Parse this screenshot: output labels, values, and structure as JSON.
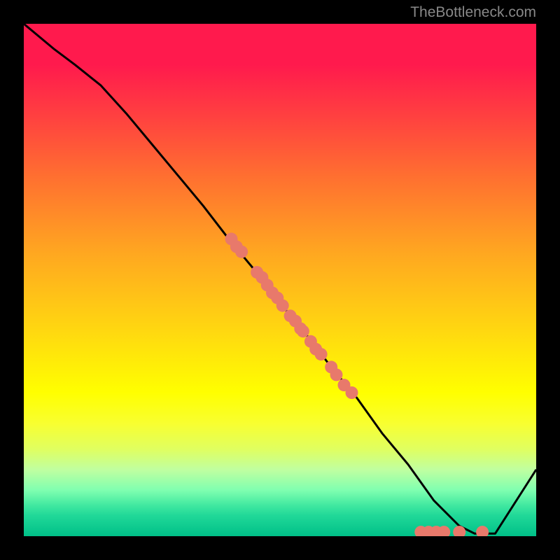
{
  "watermark": "TheBottleneck.com",
  "chart_data": {
    "type": "line",
    "title": "",
    "xlabel": "",
    "ylabel": "",
    "xlim": [
      0,
      100
    ],
    "ylim": [
      0,
      100
    ],
    "series": [
      {
        "name": "curve",
        "x": [
          0,
          6,
          10,
          15,
          20,
          25,
          30,
          35,
          40,
          45,
          50,
          55,
          60,
          65,
          70,
          75,
          80,
          85,
          88,
          92,
          100
        ],
        "y": [
          100,
          95,
          92,
          88,
          82.5,
          76.5,
          70.5,
          64.5,
          58,
          52,
          45.5,
          39.5,
          33,
          27,
          20,
          14,
          7,
          2,
          0.5,
          0.5,
          13
        ]
      }
    ],
    "markers": {
      "name": "dots",
      "color": "#e8796b",
      "points": [
        {
          "x": 40.5,
          "y": 58.0
        },
        {
          "x": 41.5,
          "y": 56.5
        },
        {
          "x": 42.5,
          "y": 55.5
        },
        {
          "x": 45.5,
          "y": 51.5
        },
        {
          "x": 46.5,
          "y": 50.5
        },
        {
          "x": 47.5,
          "y": 49.0
        },
        {
          "x": 48.5,
          "y": 47.5
        },
        {
          "x": 49.5,
          "y": 46.5
        },
        {
          "x": 50.5,
          "y": 45.0
        },
        {
          "x": 52.0,
          "y": 43.0
        },
        {
          "x": 53.0,
          "y": 42.0
        },
        {
          "x": 54.0,
          "y": 40.5
        },
        {
          "x": 54.5,
          "y": 40.0
        },
        {
          "x": 56.0,
          "y": 38.0
        },
        {
          "x": 57.0,
          "y": 36.5
        },
        {
          "x": 58.0,
          "y": 35.5
        },
        {
          "x": 60.0,
          "y": 33.0
        },
        {
          "x": 61.0,
          "y": 31.5
        },
        {
          "x": 62.5,
          "y": 29.5
        },
        {
          "x": 64.0,
          "y": 28.0
        },
        {
          "x": 77.5,
          "y": 0.8
        },
        {
          "x": 79.0,
          "y": 0.8
        },
        {
          "x": 80.5,
          "y": 0.8
        },
        {
          "x": 82.0,
          "y": 0.8
        },
        {
          "x": 85.0,
          "y": 0.8
        },
        {
          "x": 89.5,
          "y": 0.8
        }
      ]
    },
    "background": {
      "type": "vertical-gradient",
      "stops": [
        {
          "pos": 0,
          "color": "#ff1a4d"
        },
        {
          "pos": 72,
          "color": "#ffff00"
        },
        {
          "pos": 100,
          "color": "#00c088"
        }
      ]
    }
  }
}
